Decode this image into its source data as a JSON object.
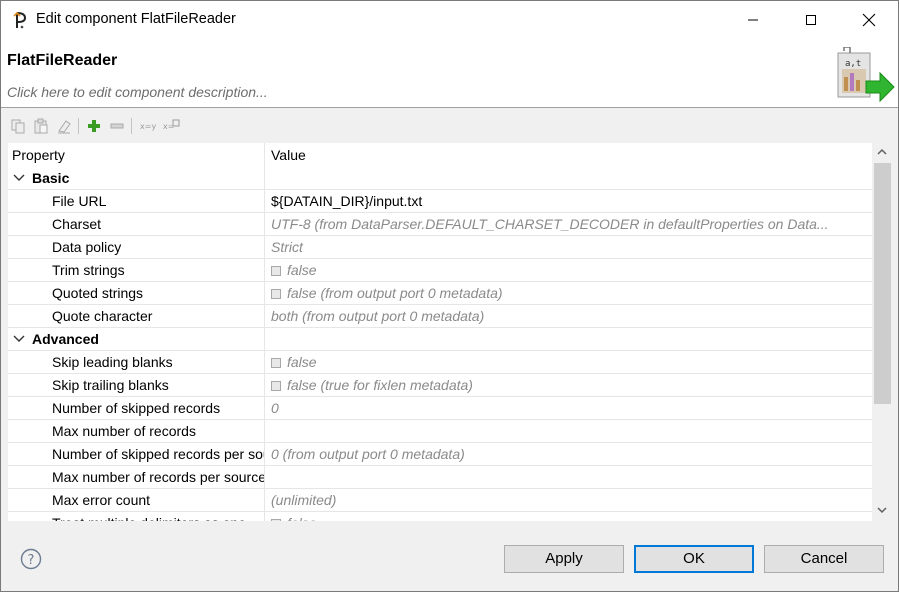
{
  "window": {
    "title": "Edit component FlatFileReader"
  },
  "header": {
    "component_name": "FlatFileReader",
    "description_placeholder": "Click here to edit component description..."
  },
  "table": {
    "columns": [
      "Property",
      "Value"
    ],
    "rows": [
      {
        "type": "group",
        "label": "Basic",
        "value": ""
      },
      {
        "type": "prop",
        "label": "File URL",
        "value": "${DATAIN_DIR}/input.txt",
        "style": "normal",
        "checkbox": false
      },
      {
        "type": "prop",
        "label": "Charset",
        "value": "UTF-8 (from DataParser.DEFAULT_CHARSET_DECODER in defaultProperties on Data...",
        "style": "grey",
        "checkbox": false
      },
      {
        "type": "prop",
        "label": "Data policy",
        "value": "Strict",
        "style": "grey",
        "checkbox": false
      },
      {
        "type": "prop",
        "label": "Trim strings",
        "value": "false",
        "style": "grey",
        "checkbox": true
      },
      {
        "type": "prop",
        "label": "Quoted strings",
        "value": "false (from output port 0 metadata)",
        "style": "grey",
        "checkbox": true
      },
      {
        "type": "prop",
        "label": "Quote character",
        "value": "both (from output port 0 metadata)",
        "style": "grey",
        "checkbox": false
      },
      {
        "type": "group",
        "label": "Advanced",
        "value": ""
      },
      {
        "type": "prop",
        "label": "Skip leading blanks",
        "value": "false",
        "style": "grey",
        "checkbox": true
      },
      {
        "type": "prop",
        "label": "Skip trailing blanks",
        "value": "false (true for fixlen metadata)",
        "style": "grey",
        "checkbox": true
      },
      {
        "type": "prop",
        "label": "Number of skipped records",
        "value": "0",
        "style": "grey",
        "checkbox": false
      },
      {
        "type": "prop",
        "label": "Max number of records",
        "value": "",
        "style": "grey",
        "checkbox": false
      },
      {
        "type": "prop",
        "label": "Number of skipped records per source",
        "value": "0 (from output port 0 metadata)",
        "style": "grey",
        "checkbox": false
      },
      {
        "type": "prop",
        "label": "Max number of records per source",
        "value": "",
        "style": "grey",
        "checkbox": false
      },
      {
        "type": "prop",
        "label": "Max error count",
        "value": "(unlimited)",
        "style": "grey",
        "checkbox": false
      },
      {
        "type": "prop",
        "label": "Treat multiple delimiters as one",
        "value": "false",
        "style": "grey",
        "checkbox": true
      }
    ]
  },
  "buttons": {
    "apply": "Apply",
    "ok": "OK",
    "cancel": "Cancel"
  },
  "colors": {
    "accent": "#0078d7",
    "add_icon": "#3a9d23",
    "graphic_arrow": "#2fb52f"
  }
}
